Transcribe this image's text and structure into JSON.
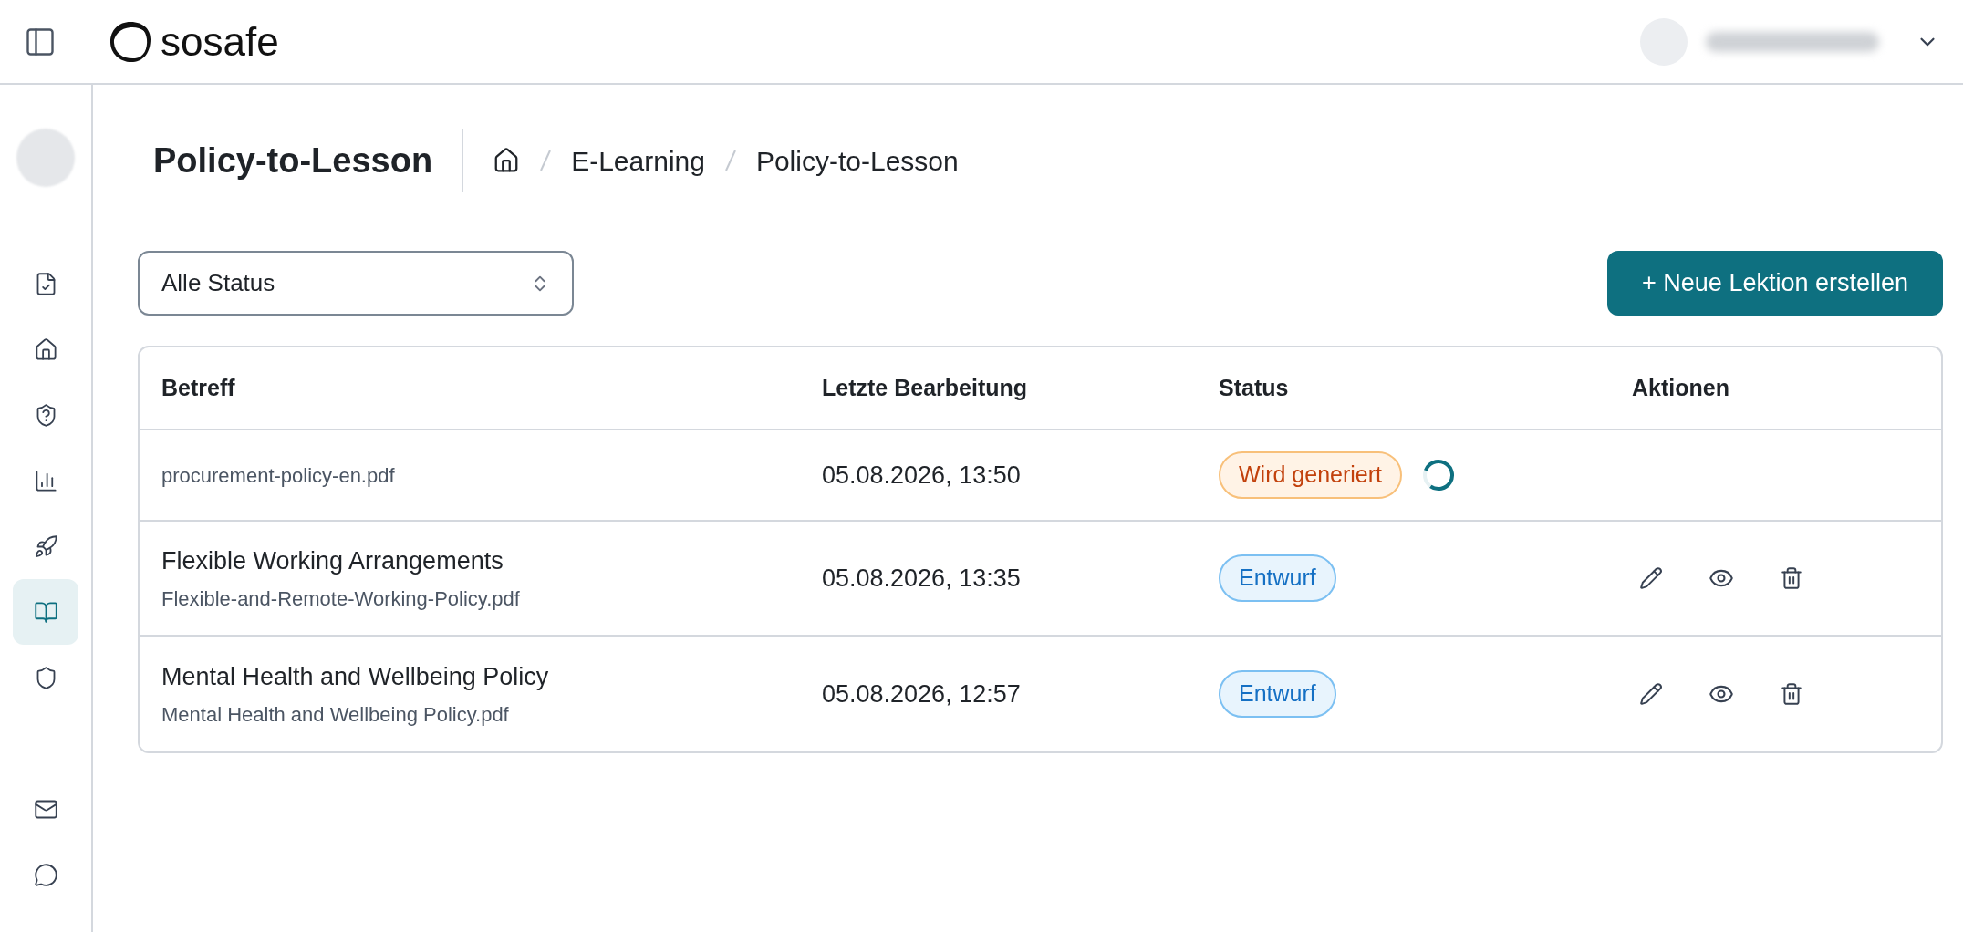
{
  "brand": {
    "name": "sosafe"
  },
  "sidebar": {
    "items": [
      {
        "selected": false
      },
      {
        "selected": false
      },
      {
        "selected": false
      },
      {
        "selected": false
      },
      {
        "selected": false
      },
      {
        "selected": true
      },
      {
        "selected": false
      }
    ],
    "bottom_items": [
      {
        "selected": false
      },
      {
        "selected": false
      }
    ]
  },
  "page": {
    "title": "Policy-to-Lesson",
    "breadcrumb": [
      "E-Learning",
      "Policy-to-Lesson"
    ]
  },
  "filter": {
    "value": "Alle Status"
  },
  "create_button": {
    "label": "+ Neue Lektion erstellen"
  },
  "table": {
    "columns": [
      "Betreff",
      "Letzte Bearbeitung",
      "Status",
      "Aktionen"
    ],
    "rows": [
      {
        "title": "",
        "file": "procurement-policy-en.pdf",
        "edited": "05.08.2026, 13:50",
        "status": {
          "label": "Wird generiert",
          "kind": "generating"
        },
        "loading": true,
        "actions": false
      },
      {
        "title": "Flexible Working Arrangements",
        "file": "Flexible-and-Remote-Working-Policy.pdf",
        "edited": "05.08.2026, 13:35",
        "status": {
          "label": "Entwurf",
          "kind": "draft"
        },
        "loading": false,
        "actions": true
      },
      {
        "title": "Mental Health and Wellbeing Policy",
        "file": "Mental Health and Wellbeing Policy.pdf",
        "edited": "05.08.2026, 12:57",
        "status": {
          "label": "Entwurf",
          "kind": "draft"
        },
        "loading": false,
        "actions": true
      }
    ]
  }
}
